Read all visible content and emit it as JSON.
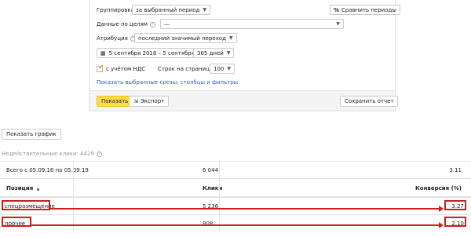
{
  "settings": {
    "grouping_label": "Группировка",
    "grouping_value": "за выбранный период",
    "compare_button": "Сравнить периоды",
    "goal_label": "Данные по целям",
    "goal_value": "—",
    "attribution_label": "Атрибуция",
    "attribution_value": "последний значимый переход",
    "date_range": "5 сентября 2018 – 5 сентября 2019",
    "days_value": "365 дней",
    "vat_label": "с учётом НДС",
    "vat_checked": true,
    "rows_label": "Строк на странице",
    "rows_value": "100",
    "show_slices_link": "Показать выбранные срезы, столбцы и фильтры"
  },
  "footer": {
    "show_button": "Показать",
    "export_button": "Экспорт",
    "save_button": "Сохранить отчет"
  },
  "show_chart_button": "Показать график",
  "invalid_clicks": "Недействительные клики: 4429",
  "table": {
    "total_label": "Всего с 05.09.18 по 05.09.19",
    "total_clicks": "6 044",
    "total_conversion": "3.11",
    "headers": {
      "position": "Позиция",
      "sort_arrow": "▲",
      "clicks": "Клики",
      "conversion": "Конверсия (%)"
    },
    "rows": [
      {
        "position": "спецразмещение",
        "clicks": "5 236",
        "conversion": "3.27"
      },
      {
        "position": "прочее",
        "clicks": "808",
        "conversion": "2.10"
      }
    ]
  },
  "colors": {
    "accent_yellow": "#ffdb4d",
    "link_blue": "#2b5fd4",
    "highlight_red": "#cc1f1f"
  }
}
